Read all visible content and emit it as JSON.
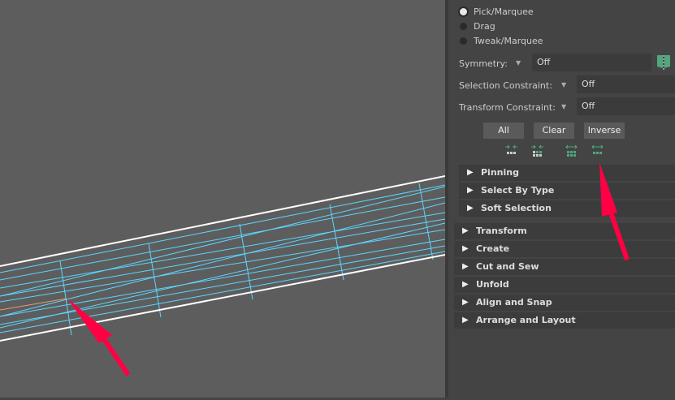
{
  "tool_modes": [
    {
      "label": "Pick/Marquee",
      "selected": true
    },
    {
      "label": "Drag",
      "selected": false
    },
    {
      "label": "Tweak/Marquee",
      "selected": false
    }
  ],
  "symmetry": {
    "label": "Symmetry:",
    "value": "Off"
  },
  "selection_constraint": {
    "label": "Selection Constraint:",
    "value": "Off"
  },
  "transform_constraint": {
    "label": "Transform Constraint:",
    "value": "Off"
  },
  "buttons": {
    "all": "All",
    "clear": "Clear",
    "inverse": "Inverse"
  },
  "icons": [
    "shrink-selection-icon",
    "shrink-selection-grid-icon",
    "grow-selection-grid-icon",
    "grow-selection-icon"
  ],
  "subsections": [
    "Pinning",
    "Select By Type",
    "Soft Selection"
  ],
  "sections": [
    "Transform",
    "Create",
    "Cut and Sew",
    "Unfold",
    "Align and Snap",
    "Arrange and Layout"
  ],
  "colors": {
    "accent": "#4fa77e",
    "wire": "#5cd6ff",
    "annotation": "#ff0044"
  }
}
